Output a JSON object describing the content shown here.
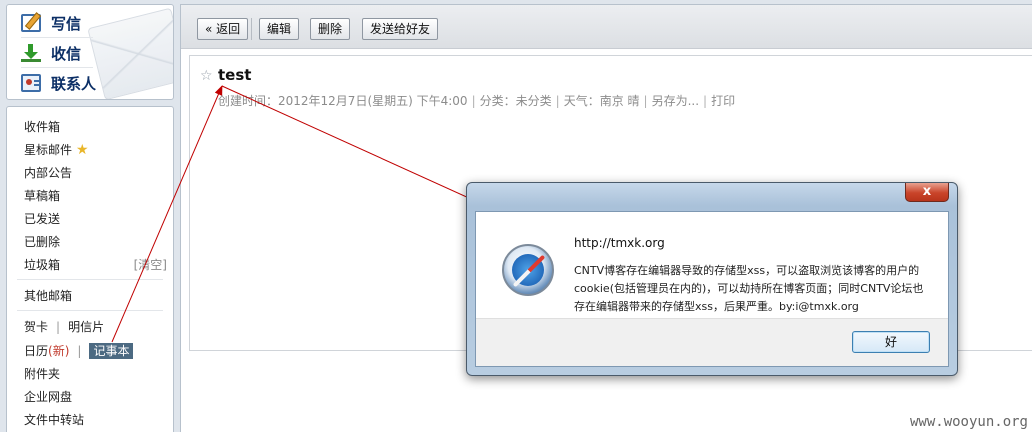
{
  "compose": {
    "write_label": "写信",
    "receive_label": "收信",
    "contacts_label": "联系人"
  },
  "folders": {
    "inbox": "收件箱",
    "starred": "星标邮件",
    "announcements": "内部公告",
    "drafts": "草稿箱",
    "sent": "已发送",
    "deleted": "已删除",
    "trash": "垃圾箱",
    "trash_clear": "[清空]",
    "other": "其他邮箱",
    "greeting_card": "贺卡",
    "postcard": "明信片",
    "calendar": "日历",
    "calendar_new": "(新)",
    "notebook": "记事本",
    "attachments": "附件夹",
    "netdisk": "企业网盘",
    "transfer": "文件中转站"
  },
  "toolbar": {
    "back": "« 返回",
    "edit": "编辑",
    "delete": "删除",
    "send_to_friend": "发送给好友"
  },
  "note": {
    "title": "test",
    "created": "创建时间：2012年12月7日(星期五) 下午4:00",
    "category": "分类：未分类",
    "weather": "天气：南京 晴",
    "save_as": "另存为...",
    "print": "打印"
  },
  "dialog": {
    "close": "x",
    "title": "http://tmxk.org",
    "message": "CNTV博客存在编辑器导致的存储型xss，可以盗取浏览该博客的用户的cookie(包括管理员在内的)，可以劫持所在博客页面；同时CNTV论坛也存在编辑器带来的存储型xss，后果严重。by:i@tmxk.org",
    "ok": "好"
  },
  "watermark": "www.wooyun.org",
  "colors": {
    "annotation_arrow": "#c00000",
    "title_text": "#0c2f66",
    "selected_bg": "#4c6a82"
  }
}
